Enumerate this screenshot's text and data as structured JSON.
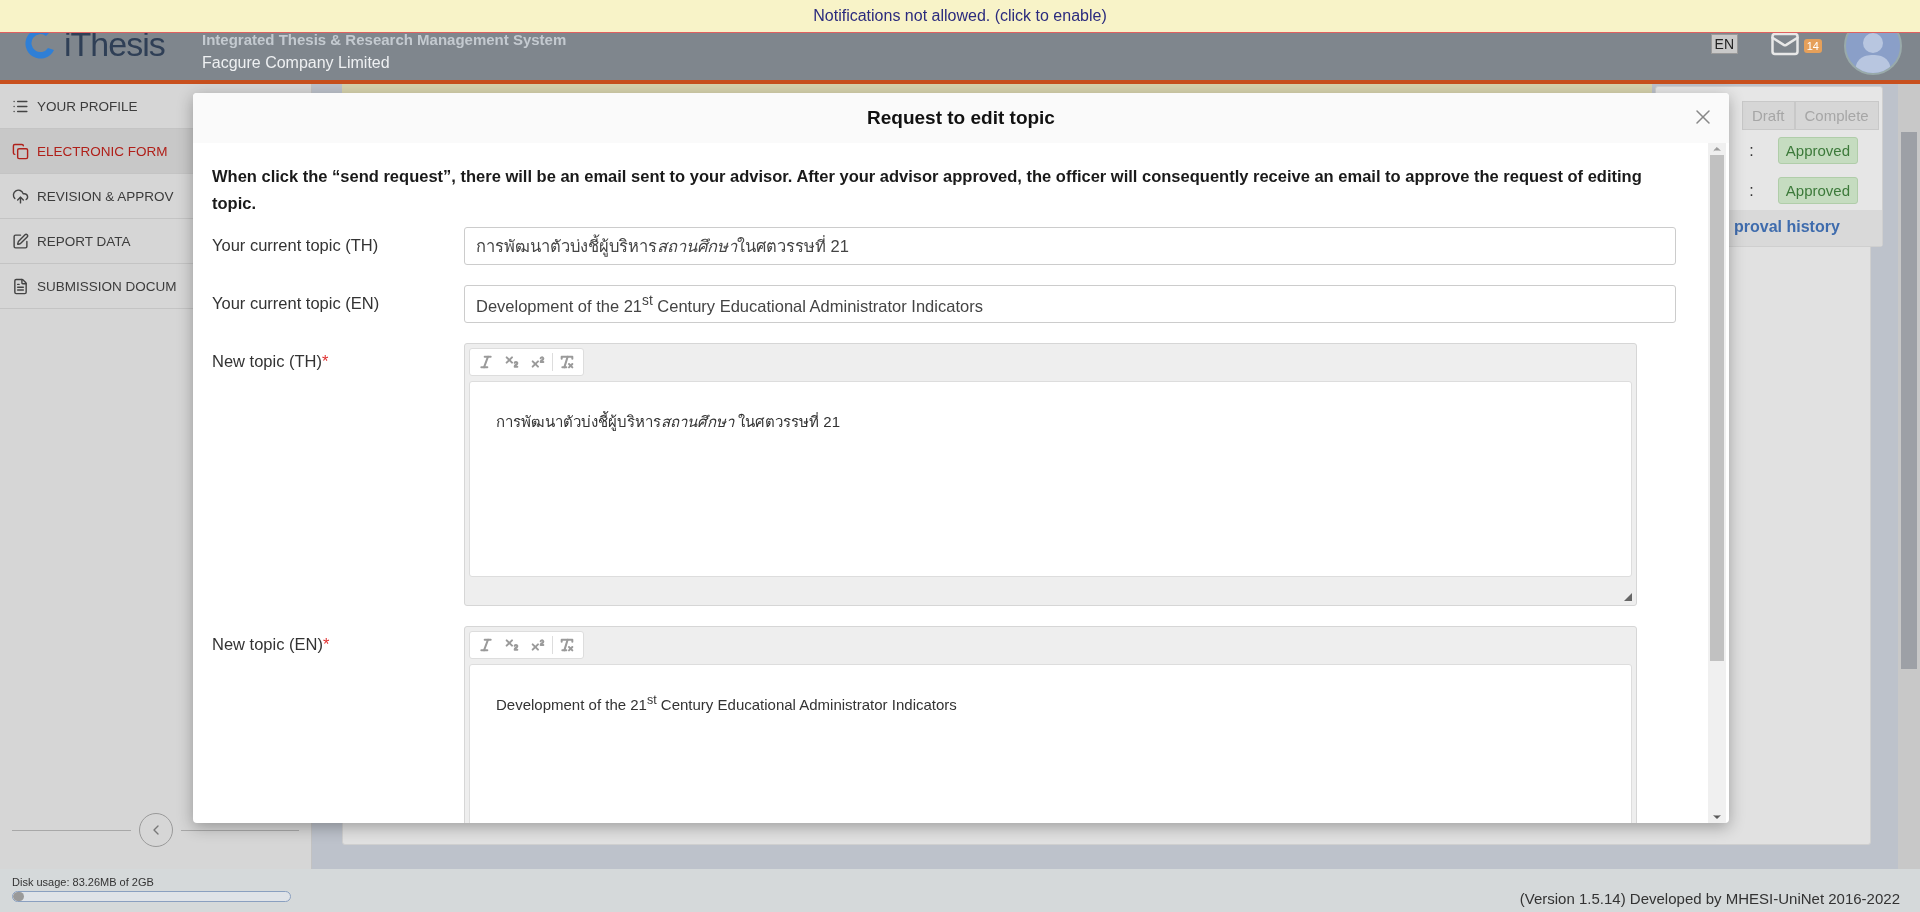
{
  "notification_bar": {
    "text": "Notifications not allowed. (click to enable)"
  },
  "header": {
    "logo_text": "iThesis",
    "title": "Integrated Thesis & Research Management System",
    "subtitle": "Facgure Company Limited",
    "language": "EN",
    "mail_count": "14"
  },
  "sidebar": {
    "items": [
      {
        "label": "YOUR PROFILE",
        "selected": false
      },
      {
        "label": "ELECTRONIC FORM",
        "selected": true
      },
      {
        "label": "REVISION & APPROV",
        "selected": false
      },
      {
        "label": "REPORT DATA",
        "selected": false
      },
      {
        "label": "SUBMISSION DOCUM",
        "selected": false
      }
    ]
  },
  "status_panel": {
    "tabs": [
      {
        "label": "Draft",
        "selected": false
      },
      {
        "label": "Complete",
        "selected": false
      }
    ],
    "rows": [
      {
        "separator": ":",
        "status": "Approved"
      },
      {
        "separator": ":",
        "status": "Approved"
      }
    ],
    "link": "proval history"
  },
  "modal": {
    "title": "Request to edit topic",
    "intro": "When click the “send request”, there will be an email sent to your advisor. After your advisor approved, the officer will consequently receive an email to approve the request of editing topic.",
    "fields": [
      {
        "kind": "text",
        "label": "Your current topic (TH)",
        "value": [
          {
            "text": "การพัฒนาตัวบ่งชี้ผู้บริหาร",
            "italic": false
          },
          {
            "text": "สถานศึกษา",
            "italic": true
          },
          {
            "text": " ในศตวรรษที่ 21",
            "italic": false
          }
        ]
      },
      {
        "kind": "text",
        "label": "Your current topic (EN)",
        "value": [
          {
            "text": "Development of the 21$^{st}$ Century Educational Administrator Indicators",
            "italic": false
          }
        ]
      },
      {
        "kind": "editor",
        "label": "New topic (TH)",
        "required_mark": "*",
        "value": [
          {
            "text": "การพัฒนาตัวบ่งชี้ผู้บริหาร",
            "italic": false
          },
          {
            "text": "สถานศึกษา",
            "italic": true
          },
          {
            "text": " ในศตวรรษที่ 21",
            "italic": false
          }
        ]
      },
      {
        "kind": "editor",
        "label": "New topic (EN)",
        "required_mark": "*",
        "value": [
          {
            "text": "Development of the 21$^{st}$ Century Educational Administrator Indicators",
            "italic": false
          }
        ]
      }
    ]
  },
  "footer": {
    "disk_usage": {
      "label": "Disk usage: 83.26MB of 2GB",
      "level": 0.04
    },
    "version": "(Version 1.5.14) Developed by MHESI-UniNet 2016-2022"
  }
}
